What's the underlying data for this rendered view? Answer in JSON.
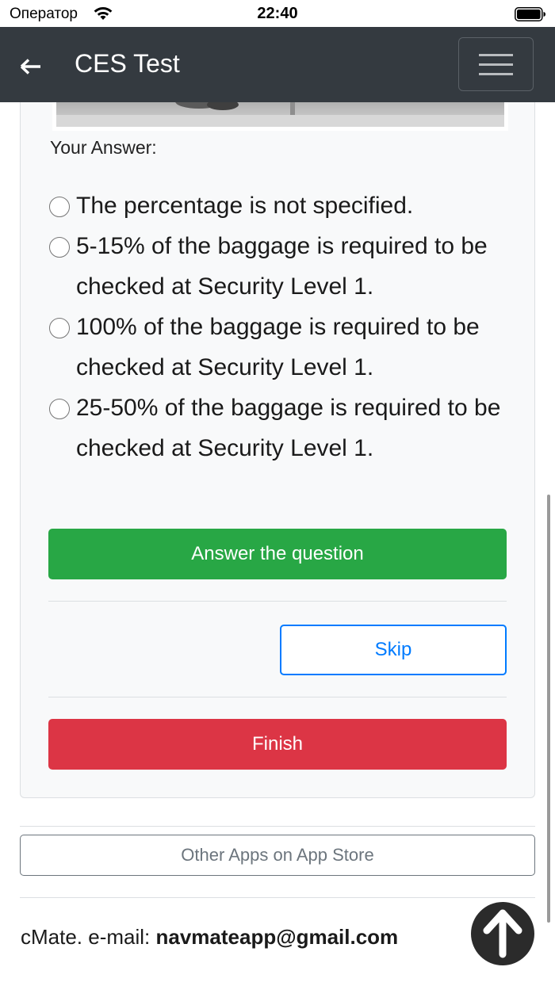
{
  "status_bar": {
    "carrier": "Оператор",
    "time": "22:40"
  },
  "navbar": {
    "title": "CES Test",
    "back_icon": "arrow-left-icon",
    "menu_icon": "hamburger-menu-icon"
  },
  "question": {
    "answer_label": "Your Answer:",
    "options": [
      {
        "label": "The percentage is not specified.",
        "selected": false
      },
      {
        "label": "5-15% of the baggage is required to be checked at Security Level 1.",
        "selected": false
      },
      {
        "label": "100% of the baggage is required to be checked at Security Level 1.",
        "selected": false
      },
      {
        "label": "25-50% of the baggage is required to be checked at Security Level 1.",
        "selected": false
      }
    ]
  },
  "actions": {
    "answer_label": "Answer the question",
    "skip_label": "Skip",
    "finish_label": "Finish"
  },
  "footer": {
    "other_apps_label": "Other Apps on App Store",
    "contact_prefix": "cMate. e-mail: ",
    "email": "navmateapp@gmail.com",
    "scroll_top_icon": "arrow-up-circle-icon"
  },
  "colors": {
    "navbar": "#343a40",
    "success": "#28a745",
    "primary": "#007bff",
    "danger": "#dc3545",
    "secondary": "#6c757d"
  }
}
